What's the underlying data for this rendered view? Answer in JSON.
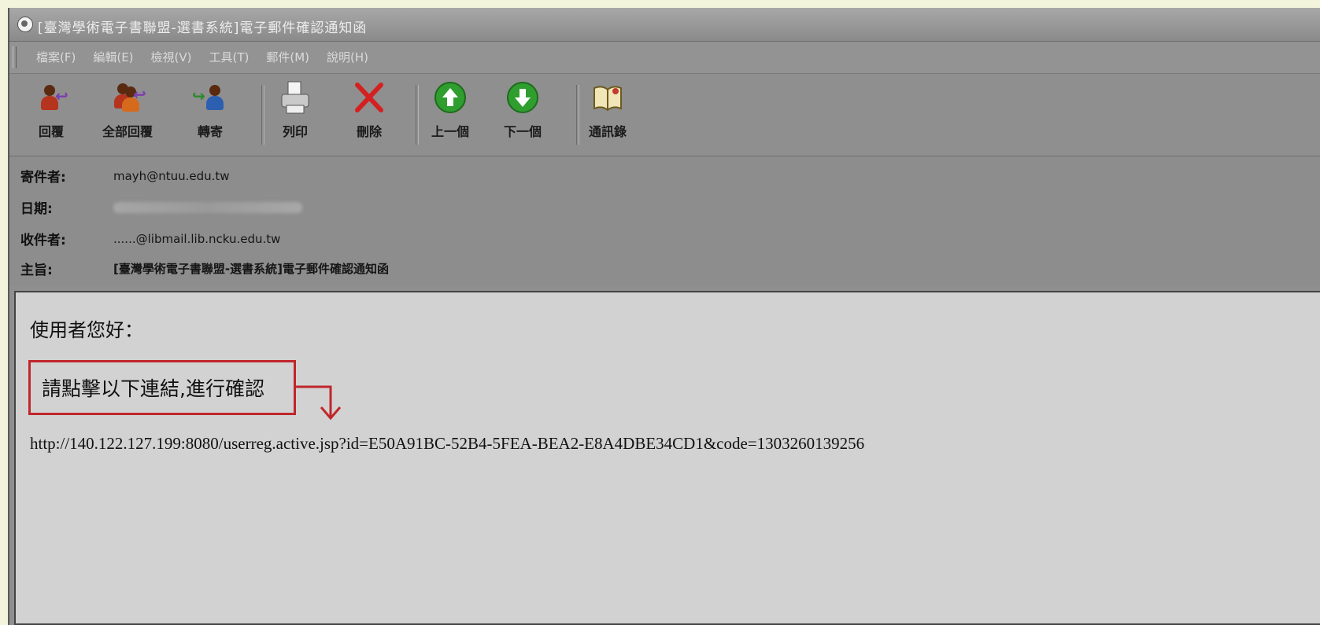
{
  "window": {
    "title": "[臺灣學術電子書聯盟-選書系統]電子郵件確認通知函"
  },
  "menu": {
    "items": [
      "檔案(F)",
      "編輯(E)",
      "檢視(V)",
      "工具(T)",
      "郵件(M)",
      "說明(H)"
    ]
  },
  "toolbar": {
    "reply": "回覆",
    "reply_all": "全部回覆",
    "forward": "轉寄",
    "print": "列印",
    "delete": "刪除",
    "previous": "上一個",
    "next": "下一個",
    "address_book": "通訊錄"
  },
  "header": {
    "from_label": "寄件者:",
    "from_value": "mayh@ntuu.edu.tw",
    "date_label": "日期:",
    "to_label": "收件者:",
    "to_value": "......@libmail.lib.ncku.edu.tw",
    "subject_label": "主旨:",
    "subject_value": "[臺灣學術電子書聯盟-選書系統]電子郵件確認通知函"
  },
  "body": {
    "greeting": "使用者您好：",
    "instruction": "請點擊以下連結,進行確認",
    "link": "http://140.122.127.199:8080/userreg.active.jsp?id=E50A91BC-52B4-5FEA-BEA2-E8A4DBE34CD1&code=1303260139256"
  },
  "colors": {
    "highlight_red": "#c0262b",
    "page_background": "#f2f5dc"
  }
}
